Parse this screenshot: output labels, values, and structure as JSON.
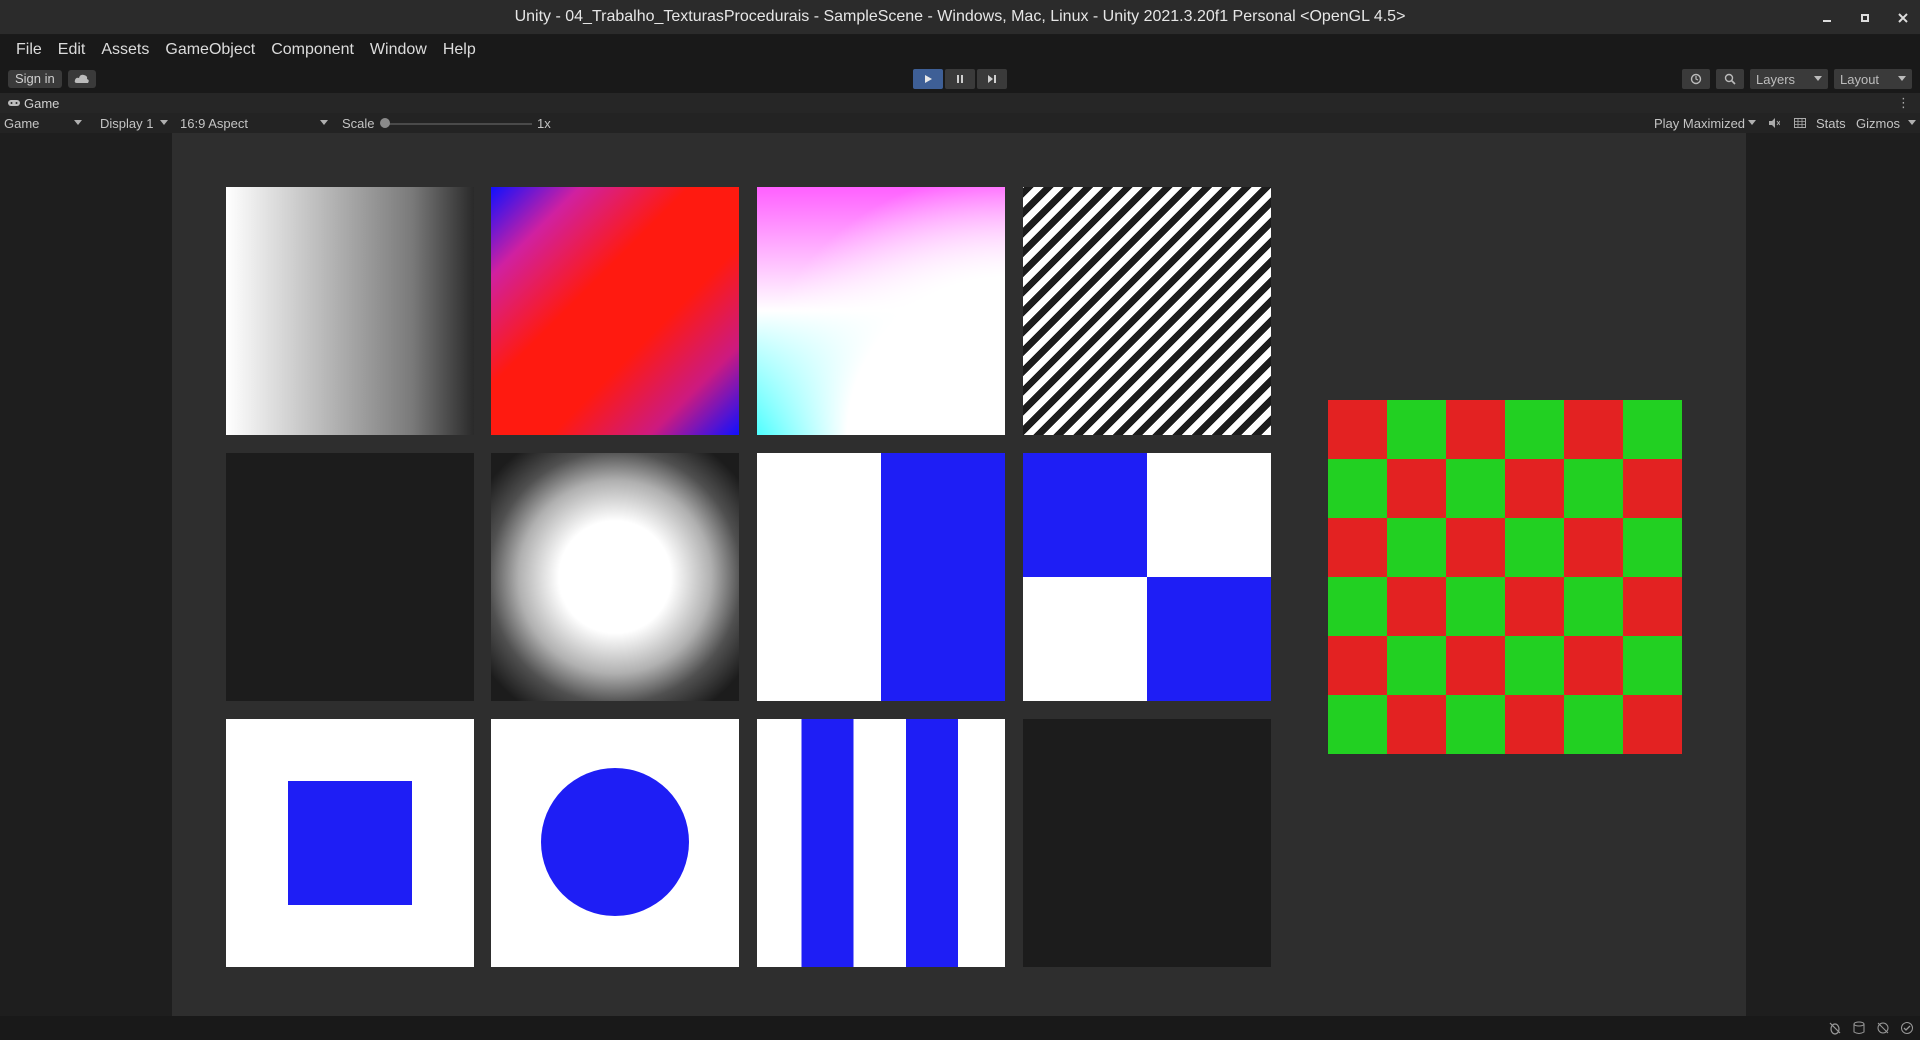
{
  "window": {
    "title": "Unity - 04_Trabalho_TexturasProcedurais - SampleScene - Windows, Mac, Linux - Unity 2021.3.20f1 Personal <OpenGL 4.5>"
  },
  "menu": [
    "File",
    "Edit",
    "Assets",
    "GameObject",
    "Component",
    "Window",
    "Help"
  ],
  "toolbar": {
    "signin_label": "Sign in",
    "layers_label": "Layers",
    "layout_label": "Layout"
  },
  "tab": {
    "label": "Game"
  },
  "gamebar": {
    "mode": "Game",
    "display": "Display 1",
    "aspect": "16:9 Aspect",
    "scale_label": "Scale",
    "scale_value": "1x",
    "play_maximized": "Play Maximized",
    "stats": "Stats",
    "gizmos": "Gizmos"
  },
  "colors": {
    "blue": "#1e1ef5",
    "red": "#e32222",
    "green": "#22d022",
    "white": "#ffffff",
    "dark_tile": "#1c1c1c",
    "play_active": "#3e5f96"
  },
  "checkerboard": {
    "rows": 6,
    "cols": 6,
    "first": "red"
  },
  "icons": [
    "cloud-icon",
    "play-icon",
    "pause-icon",
    "step-icon",
    "history-icon",
    "search-icon",
    "audio-mute-icon",
    "grid-icon",
    "kebab-icon"
  ]
}
